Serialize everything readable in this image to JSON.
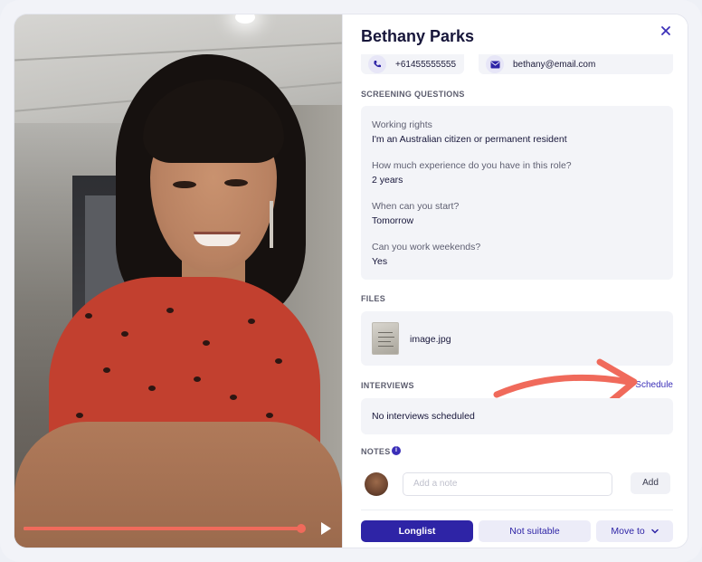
{
  "candidate": {
    "name": "Bethany Parks",
    "phone": "+61455555555",
    "email": "bethany@email.com"
  },
  "video": {
    "progress": 0.99
  },
  "screening": {
    "label": "SCREENING QUESTIONS",
    "items": [
      {
        "question": "Working rights",
        "answer": "I'm an Australian citizen or permanent resident"
      },
      {
        "question": "How much experience do you have in this role?",
        "answer": "2 years"
      },
      {
        "question": "When can you start?",
        "answer": "Tomorrow"
      },
      {
        "question": "Can you work weekends?",
        "answer": "Yes"
      }
    ]
  },
  "files": {
    "label": "FILES",
    "items": [
      {
        "name": "image.jpg"
      }
    ]
  },
  "interviews": {
    "label": "INTERVIEWS",
    "schedule_label": "Schedule",
    "empty_text": "No interviews scheduled"
  },
  "notes": {
    "label": "NOTES",
    "info_glyph": "i",
    "placeholder": "Add a note",
    "add_label": "Add"
  },
  "actions": {
    "longlist": "Longlist",
    "not_suitable": "Not suitable",
    "move_to": "Move to"
  },
  "colors": {
    "accent": "#2e24a6",
    "annotation_arrow": "#f06a5b"
  },
  "icons": {
    "close": "close-icon",
    "phone": "phone-icon",
    "email": "email-icon",
    "play": "play-icon",
    "info": "info-icon",
    "chevron": "chevron-down-icon"
  }
}
